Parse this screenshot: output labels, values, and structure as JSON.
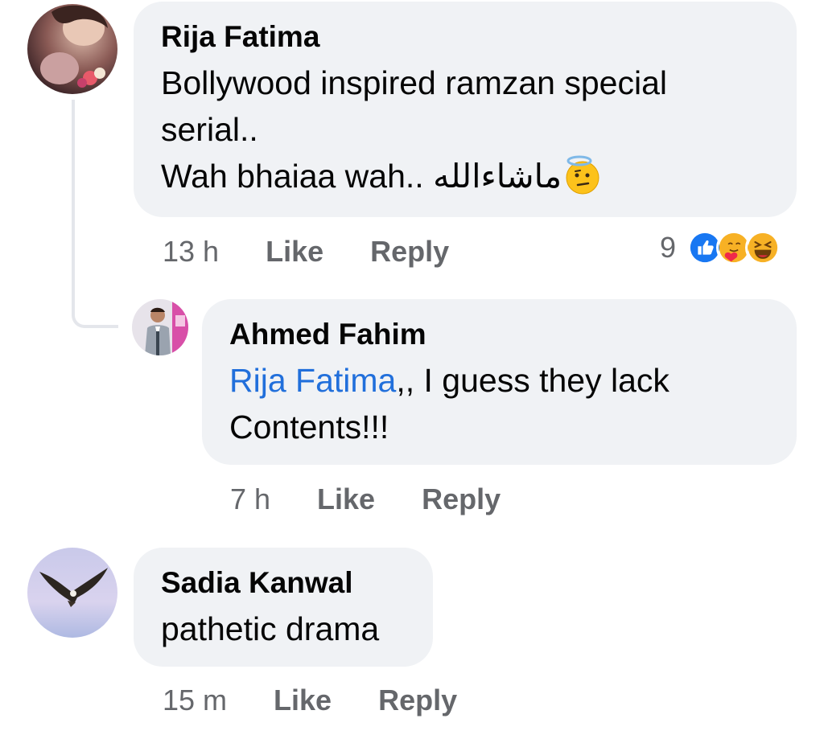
{
  "comments": [
    {
      "author": "Rija Fatima",
      "line1": "Bollywood inspired ramzan special",
      "line2": "serial..",
      "line3": "Wah bhaiaa wah.. ",
      "urdu": "ماشاءالله",
      "emoji": "halo-thinking-face-icon",
      "time": "13 h",
      "like": "Like",
      "reply": "Reply",
      "reaction_count": "9",
      "reactions": [
        "like-icon",
        "care-icon",
        "haha-icon"
      ]
    },
    {
      "author": "Ahmed Fahim",
      "mention": "Rija Fatima",
      "line1_rest": ",, I guess they lack",
      "line2": "Contents!!!",
      "time": "7 h",
      "like": "Like",
      "reply": "Reply"
    },
    {
      "author": "Sadia Kanwal",
      "line1": "pathetic drama",
      "time": "15 m",
      "like": "Like",
      "reply": "Reply"
    }
  ],
  "colors": {
    "bubble": "#f0f2f5",
    "text": "#050505",
    "meta": "#65676b",
    "mention": "#216fdb",
    "like_blue": "#1877f2",
    "reaction_yellow": "#f7b125"
  }
}
